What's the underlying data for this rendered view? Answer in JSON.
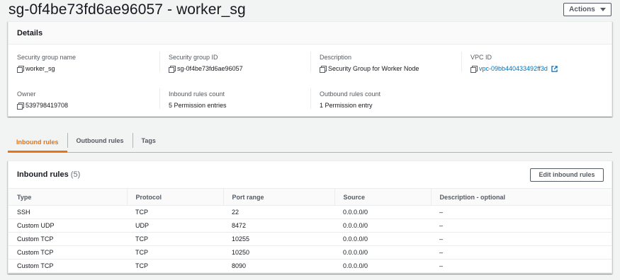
{
  "page": {
    "title": "sg-0f4be73fd6ae96057 - worker_sg"
  },
  "actions": {
    "label": "Actions"
  },
  "details": {
    "header": "Details",
    "fields": {
      "sg_name": {
        "label": "Security group name",
        "value": "worker_sg"
      },
      "sg_id": {
        "label": "Security group ID",
        "value": "sg-0f4be73fd6ae96057"
      },
      "description": {
        "label": "Description",
        "value": "Security Group for Worker Node"
      },
      "vpc_id": {
        "label": "VPC ID",
        "value": "vpc-09bb440433492ff3d"
      },
      "owner": {
        "label": "Owner",
        "value": "539798419708"
      },
      "inbound_count": {
        "label": "Inbound rules count",
        "value": "5 Permission entries"
      },
      "outbound_count": {
        "label": "Outbound rules count",
        "value": "1 Permission entry"
      }
    }
  },
  "tabs": [
    {
      "label": "Inbound rules",
      "active": true
    },
    {
      "label": "Outbound rules",
      "active": false
    },
    {
      "label": "Tags",
      "active": false
    }
  ],
  "inbound": {
    "title": "Inbound rules",
    "count": "(5)",
    "edit_label": "Edit inbound rules",
    "columns": [
      "Type",
      "Protocol",
      "Port range",
      "Source",
      "Description - optional"
    ],
    "rows": [
      [
        "SSH",
        "TCP",
        "22",
        "0.0.0.0/0",
        "–"
      ],
      [
        "Custom UDP",
        "UDP",
        "8472",
        "0.0.0.0/0",
        "–"
      ],
      [
        "Custom TCP",
        "TCP",
        "10255",
        "0.0.0.0/0",
        "–"
      ],
      [
        "Custom TCP",
        "TCP",
        "10250",
        "0.0.0.0/0",
        "–"
      ],
      [
        "Custom TCP",
        "TCP",
        "8090",
        "0.0.0.0/0",
        "–"
      ]
    ]
  },
  "colors": {
    "link": "#0073bb",
    "active_tab": "#ec7211",
    "background": "#f2f3f3"
  }
}
